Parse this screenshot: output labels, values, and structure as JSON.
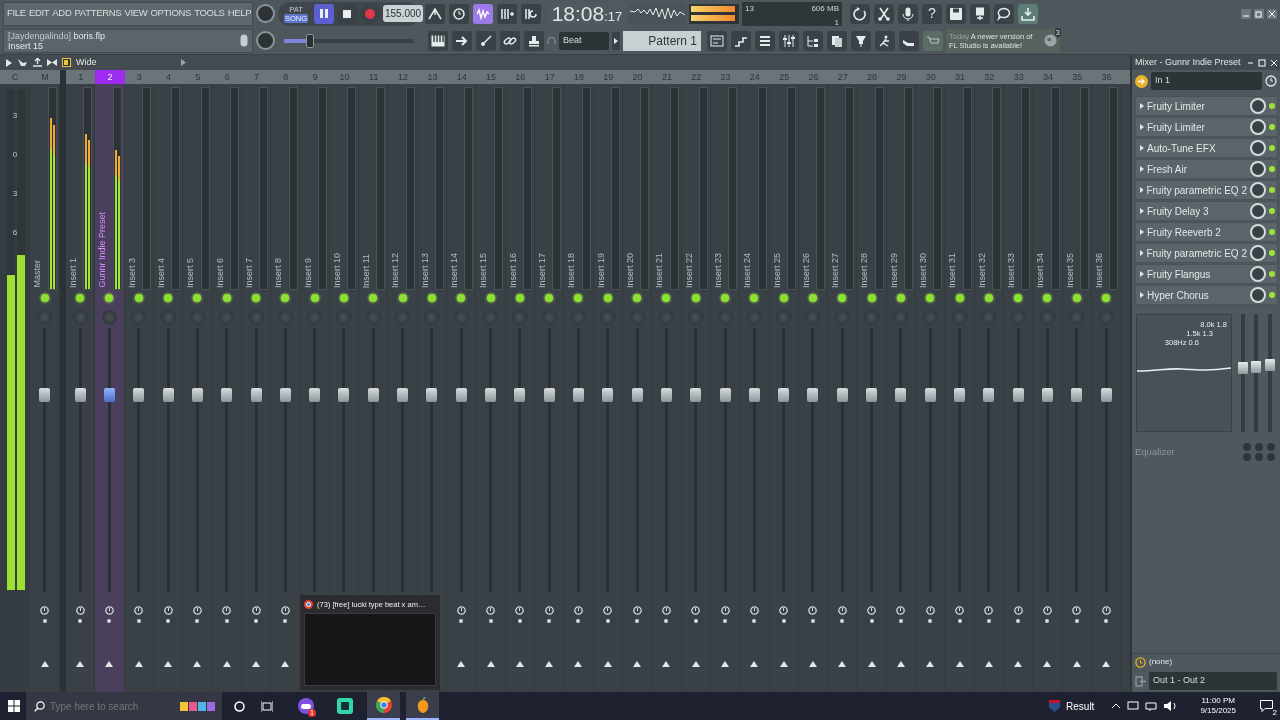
{
  "menu": [
    "FILE",
    "EDIT",
    "ADD",
    "PATTERNS",
    "VIEW",
    "OPTIONS",
    "TOOLS",
    "HELP"
  ],
  "hint": {
    "project": "[Jaydengalindo]",
    "file": "boris.flp",
    "target": "Insert 15"
  },
  "modes": [
    {
      "label": "PAT",
      "selected": false
    },
    {
      "label": "SONG",
      "selected": true
    }
  ],
  "playing": true,
  "tempo": "155.000",
  "main_slider": {
    "level": 0.2
  },
  "clock": {
    "main": "18:08",
    "seconds": ":17"
  },
  "output_meter": {
    "level": 0.95
  },
  "cpu": {
    "cpu": "13",
    "memory": "606 MB",
    "polyphony": "1"
  },
  "help_label": "?",
  "pattern": {
    "channel": "Beat",
    "name": "Pattern 1"
  },
  "news": {
    "date": "Today",
    "message": "A newer version of FL Studio is available!",
    "count": "3"
  },
  "mixer_toolbar": {
    "view": "Wide"
  },
  "master_meter": {
    "header": "C",
    "scale": [
      "3",
      "0",
      "3",
      "6"
    ],
    "bars": [
      {
        "level": 0.63
      },
      {
        "level": 0.67
      }
    ]
  },
  "channels": [
    {
      "number": "M",
      "label": "Master",
      "selected": false,
      "enabled": true,
      "meter": {
        "level": 0.85
      },
      "fader": {
        "level": 0.76
      }
    },
    {
      "number": "1",
      "label": "Insert 1",
      "selected": false,
      "enabled": true,
      "meter": {
        "level": 0.77
      },
      "fader": {
        "level": 0.76
      }
    },
    {
      "number": "2",
      "label": "Gunnr Indie Preset",
      "selected": true,
      "enabled": true,
      "meter": {
        "level": 0.69
      },
      "fader": {
        "level": 0.76
      }
    },
    {
      "number": "3",
      "label": "Insert 3",
      "selected": false,
      "enabled": true,
      "meter": {
        "level": 0
      },
      "fader": {
        "level": 0.76
      }
    },
    {
      "number": "4",
      "label": "Insert 4",
      "selected": false,
      "enabled": true,
      "meter": {
        "level": 0
      },
      "fader": {
        "level": 0.76
      }
    },
    {
      "number": "5",
      "label": "Insert 5",
      "selected": false,
      "enabled": true,
      "meter": {
        "level": 0
      },
      "fader": {
        "level": 0.76
      }
    },
    {
      "number": "6",
      "label": "Insert 6",
      "selected": false,
      "enabled": true,
      "meter": {
        "level": 0
      },
      "fader": {
        "level": 0.76
      }
    },
    {
      "number": "7",
      "label": "Insert 7",
      "selected": false,
      "enabled": true,
      "meter": {
        "level": 0
      },
      "fader": {
        "level": 0.76
      }
    },
    {
      "number": "8",
      "label": "Insert 8",
      "selected": false,
      "enabled": true,
      "meter": {
        "level": 0
      },
      "fader": {
        "level": 0.76
      }
    },
    {
      "number": "9",
      "label": "Insert 9",
      "selected": false,
      "enabled": true,
      "meter": {
        "level": 0
      },
      "fader": {
        "level": 0.76
      }
    },
    {
      "number": "10",
      "label": "Insert 10",
      "selected": false,
      "enabled": true,
      "meter": {
        "level": 0
      },
      "fader": {
        "level": 0.76
      }
    },
    {
      "number": "11",
      "label": "Insert 11",
      "selected": false,
      "enabled": true,
      "meter": {
        "level": 0
      },
      "fader": {
        "level": 0.76
      }
    },
    {
      "number": "12",
      "label": "Insert 12",
      "selected": false,
      "enabled": true,
      "meter": {
        "level": 0
      },
      "fader": {
        "level": 0.76
      }
    },
    {
      "number": "13",
      "label": "Insert 13",
      "selected": false,
      "enabled": true,
      "meter": {
        "level": 0
      },
      "fader": {
        "level": 0.76
      }
    },
    {
      "number": "14",
      "label": "Insert 14",
      "selected": false,
      "enabled": true,
      "meter": {
        "level": 0
      },
      "fader": {
        "level": 0.76
      }
    },
    {
      "number": "15",
      "label": "Insert 15",
      "selected": false,
      "enabled": true,
      "meter": {
        "level": 0
      },
      "fader": {
        "level": 0.76
      }
    },
    {
      "number": "16",
      "label": "Insert 16",
      "selected": false,
      "enabled": true,
      "meter": {
        "level": 0
      },
      "fader": {
        "level": 0.76
      }
    },
    {
      "number": "17",
      "label": "Insert 17",
      "selected": false,
      "enabled": true,
      "meter": {
        "level": 0
      },
      "fader": {
        "level": 0.76
      }
    },
    {
      "number": "18",
      "label": "Insert 18",
      "selected": false,
      "enabled": true,
      "meter": {
        "level": 0
      },
      "fader": {
        "level": 0.76
      }
    },
    {
      "number": "19",
      "label": "Insert 19",
      "selected": false,
      "enabled": true,
      "meter": {
        "level": 0
      },
      "fader": {
        "level": 0.76
      }
    },
    {
      "number": "20",
      "label": "Insert 20",
      "selected": false,
      "enabled": true,
      "meter": {
        "level": 0
      },
      "fader": {
        "level": 0.76
      }
    },
    {
      "number": "21",
      "label": "Insert 21",
      "selected": false,
      "enabled": true,
      "meter": {
        "level": 0
      },
      "fader": {
        "level": 0.76
      }
    },
    {
      "number": "22",
      "label": "Insert 22",
      "selected": false,
      "enabled": true,
      "meter": {
        "level": 0
      },
      "fader": {
        "level": 0.76
      }
    },
    {
      "number": "23",
      "label": "Insert 23",
      "selected": false,
      "enabled": true,
      "meter": {
        "level": 0
      },
      "fader": {
        "level": 0.76
      }
    },
    {
      "number": "24",
      "label": "Insert 24",
      "selected": false,
      "enabled": true,
      "meter": {
        "level": 0
      },
      "fader": {
        "level": 0.76
      }
    },
    {
      "number": "25",
      "label": "Insert 25",
      "selected": false,
      "enabled": true,
      "meter": {
        "level": 0
      },
      "fader": {
        "level": 0.76
      }
    },
    {
      "number": "26",
      "label": "Insert 26",
      "selected": false,
      "enabled": true,
      "meter": {
        "level": 0
      },
      "fader": {
        "level": 0.76
      }
    },
    {
      "number": "27",
      "label": "Insert 27",
      "selected": false,
      "enabled": true,
      "meter": {
        "level": 0
      },
      "fader": {
        "level": 0.76
      }
    },
    {
      "number": "28",
      "label": "Insert 28",
      "selected": false,
      "enabled": true,
      "meter": {
        "level": 0
      },
      "fader": {
        "level": 0.76
      }
    },
    {
      "number": "29",
      "label": "Insert 29",
      "selected": false,
      "enabled": true,
      "meter": {
        "level": 0
      },
      "fader": {
        "level": 0.76
      }
    },
    {
      "number": "30",
      "label": "Insert 30",
      "selected": false,
      "enabled": true,
      "meter": {
        "level": 0
      },
      "fader": {
        "level": 0.76
      }
    },
    {
      "number": "31",
      "label": "Insert 31",
      "selected": false,
      "enabled": true,
      "meter": {
        "level": 0
      },
      "fader": {
        "level": 0.76
      }
    },
    {
      "number": "32",
      "label": "Insert 32",
      "selected": false,
      "enabled": true,
      "meter": {
        "level": 0
      },
      "fader": {
        "level": 0.76
      }
    },
    {
      "number": "33",
      "label": "Insert 33",
      "selected": false,
      "enabled": true,
      "meter": {
        "level": 0
      },
      "fader": {
        "level": 0.76
      }
    },
    {
      "number": "34",
      "label": "Insert 34",
      "selected": false,
      "enabled": true,
      "meter": {
        "level": 0
      },
      "fader": {
        "level": 0.76
      }
    },
    {
      "number": "35",
      "label": "Insert 35",
      "selected": false,
      "enabled": true,
      "meter": {
        "level": 0
      },
      "fader": {
        "level": 0.76
      }
    },
    {
      "number": "36",
      "label": "Insert 36",
      "selected": false,
      "enabled": true,
      "meter": {
        "level": 0
      },
      "fader": {
        "level": 0.76
      }
    }
  ],
  "panel": {
    "title": "Mixer - Gunnr Indie Preset",
    "input": "In 1",
    "slots": [
      {
        "name": "Fruity Limiter",
        "on": true
      },
      {
        "name": "Fruity Limiter",
        "on": true
      },
      {
        "name": "Auto-Tune EFX",
        "on": true
      },
      {
        "name": "Fresh Air",
        "on": true
      },
      {
        "name": "Fruity parametric EQ 2",
        "on": true
      },
      {
        "name": "Fruity Delay 3",
        "on": true
      },
      {
        "name": "Fruity Reeverb 2",
        "on": true
      },
      {
        "name": "Fruity parametric EQ 2",
        "on": true
      },
      {
        "name": "Fruity Flangus",
        "on": true
      },
      {
        "name": "Hyper Chorus",
        "on": true
      }
    ],
    "eq_labels": [
      "8.0k 1.8",
      "1.5k 1.3",
      "308Hz 0.6"
    ],
    "eq_sliders": [
      {
        "level": 0.55
      },
      {
        "level": 0.56
      },
      {
        "level": 0.58
      }
    ],
    "eq_name": "Equalizer",
    "send": "(none)",
    "output": "Out 1 - Out 2"
  },
  "taskbar": {
    "search": {
      "placeholder": "Type here to search"
    },
    "apps": [
      {
        "kind": "gamepad",
        "selected": false,
        "badge": "1"
      },
      {
        "kind": "square",
        "selected": false
      },
      {
        "kind": "browser",
        "selected": true
      },
      {
        "kind": "fruit",
        "selected": true
      }
    ],
    "weather": "Result",
    "time": "11:00 PM",
    "date": "9/15/2025",
    "notifications": "2",
    "preview": {
      "title": "(73) [free] lucki type beat x am…"
    }
  }
}
